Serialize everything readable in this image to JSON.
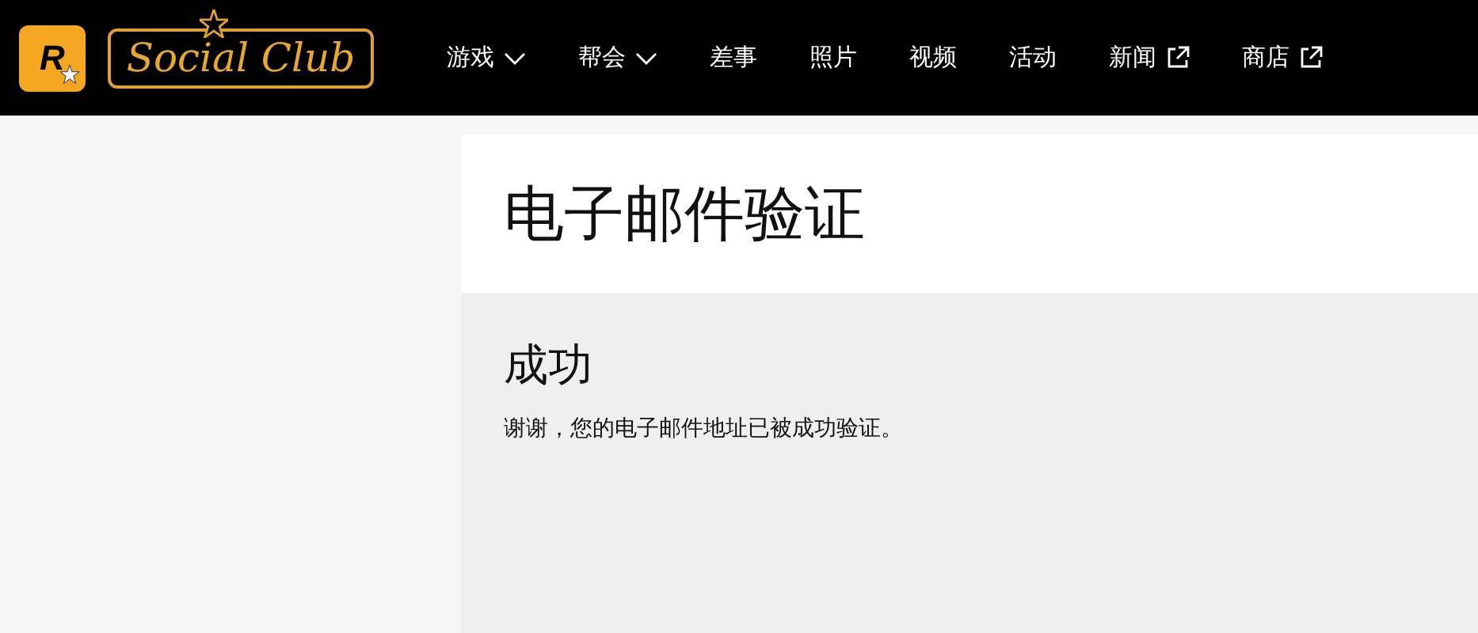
{
  "header": {
    "logo": {
      "badge": "R",
      "wordmark": "Social Club"
    },
    "nav": [
      {
        "label": "游戏",
        "kind": "dropdown"
      },
      {
        "label": "帮会",
        "kind": "dropdown"
      },
      {
        "label": "差事",
        "kind": "plain"
      },
      {
        "label": "照片",
        "kind": "plain"
      },
      {
        "label": "视频",
        "kind": "plain"
      },
      {
        "label": "活动",
        "kind": "plain"
      },
      {
        "label": "新闻",
        "kind": "external"
      },
      {
        "label": "商店",
        "kind": "external"
      }
    ]
  },
  "page": {
    "title": "电子邮件验证",
    "heading": "成功",
    "message": "谢谢，您的电子邮件地址已被成功验证。"
  }
}
